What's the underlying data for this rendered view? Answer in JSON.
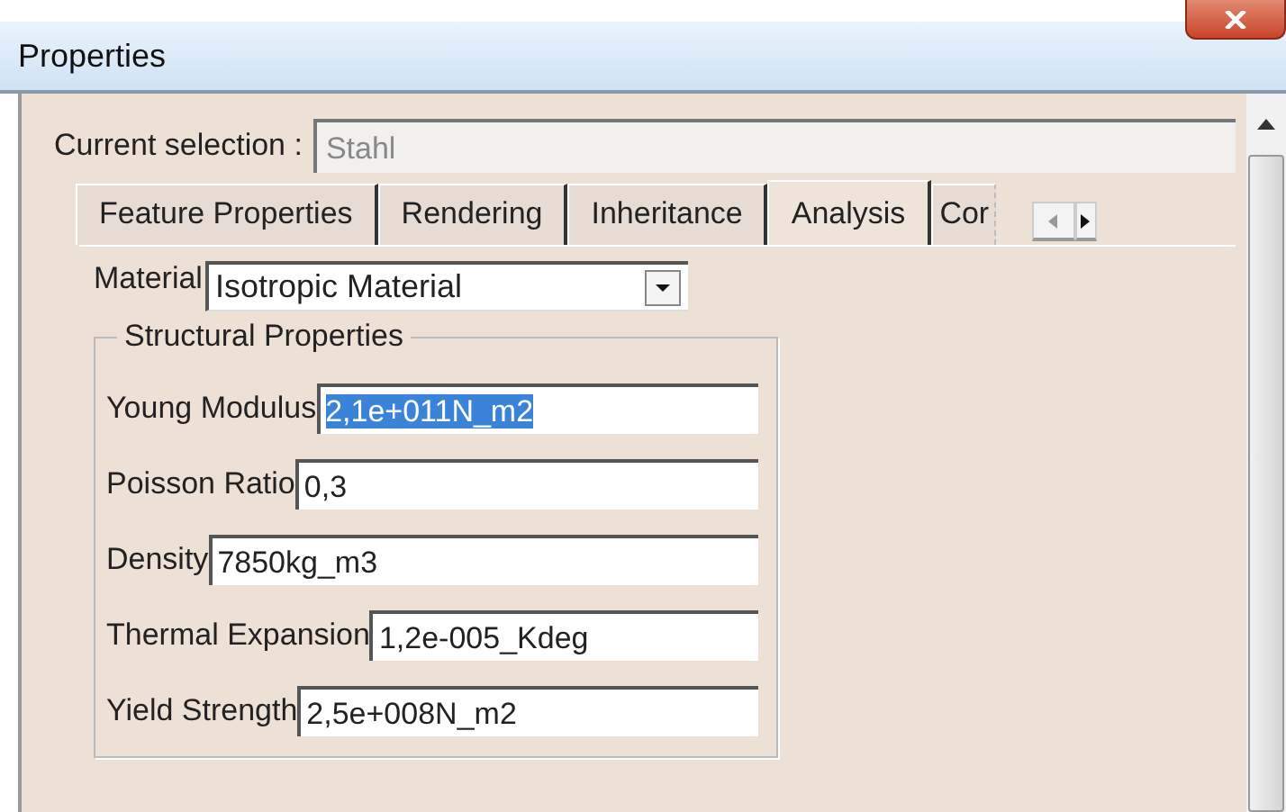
{
  "window": {
    "title": "Properties"
  },
  "current_selection": {
    "label": "Current selection :",
    "value": "Stahl"
  },
  "tabs": [
    {
      "label": "Feature Properties",
      "selected": false
    },
    {
      "label": "Rendering",
      "selected": false
    },
    {
      "label": "Inheritance",
      "selected": false
    },
    {
      "label": "Analysis",
      "selected": true
    },
    {
      "label": "Cor",
      "selected": false
    }
  ],
  "material": {
    "label": "Material",
    "value": "Isotropic Material"
  },
  "structural_properties": {
    "title": "Structural Properties",
    "fields": [
      {
        "label": "Young Modulus",
        "value": "2,1e+011N_m2",
        "selected": true
      },
      {
        "label": "Poisson Ratio",
        "value": "0,3",
        "selected": false
      },
      {
        "label": "Density",
        "value": "7850kg_m3",
        "selected": false
      },
      {
        "label": "Thermal Expansion",
        "value": "1,2e-005_Kdeg",
        "selected": false
      },
      {
        "label": "Yield Strength",
        "value": "2,5e+008N_m2",
        "selected": false
      }
    ]
  }
}
